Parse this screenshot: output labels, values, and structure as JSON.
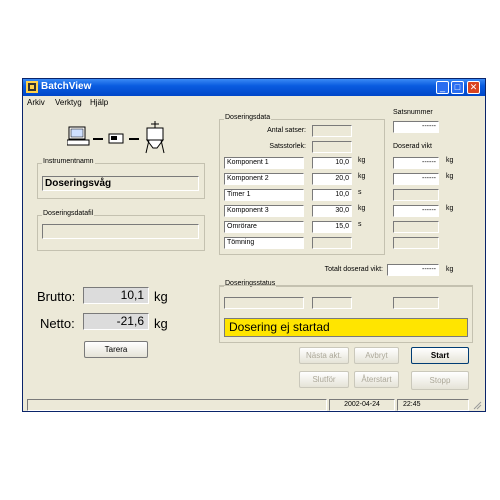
{
  "window": {
    "title": "BatchView"
  },
  "menu": {
    "items": [
      "Arkiv",
      "Verktyg",
      "Hjälp"
    ]
  },
  "instrument": {
    "group_label": "Instrumentnamn",
    "value": "Doseringsvåg"
  },
  "dosing_file": {
    "group_label": "Doseringsdatafil",
    "value": ""
  },
  "weights": {
    "brutto_label": "Brutto:",
    "brutto_value": "10,1",
    "netto_label": "Netto:",
    "netto_value": "-21,6",
    "unit": "kg"
  },
  "tare_button": "Tarera",
  "doseringsdata": {
    "group_label": "Doseringsdata",
    "antal_satser_label": "Antal satser:",
    "satsstorlek_label": "Satsstorlek:",
    "rows": [
      {
        "name": "Komponent 1",
        "value": "10,0",
        "unit": "kg",
        "dosed": "------",
        "dosed_unit": "kg"
      },
      {
        "name": "Komponent 2",
        "value": "20,0",
        "unit": "kg",
        "dosed": "------",
        "dosed_unit": "kg"
      },
      {
        "name": "Timer 1",
        "value": "10,0",
        "unit": "s",
        "dosed": "",
        "dosed_unit": ""
      },
      {
        "name": "Komponent 3",
        "value": "30,0",
        "unit": "kg",
        "dosed": "------",
        "dosed_unit": "kg"
      },
      {
        "name": "Omrörare",
        "value": "15,0",
        "unit": "s",
        "dosed": "",
        "dosed_unit": ""
      },
      {
        "name": "Tömning",
        "value": "",
        "unit": "",
        "dosed": "",
        "dosed_unit": ""
      }
    ]
  },
  "satsnummer": {
    "label": "Satsnummer",
    "value": "------"
  },
  "doserad_vikt_label": "Doserad vikt",
  "total": {
    "label": "Totalt doserad vikt:",
    "value": "------",
    "unit": "kg"
  },
  "doseringsstatus": {
    "group_label": "Doseringsstatus",
    "message": "Dosering ej startad"
  },
  "buttons": {
    "nasta_akt": "Nästa akt.",
    "avbryt": "Avbryt",
    "start": "Start",
    "slutfor": "Slutför",
    "aterstart": "Återstart",
    "stopp": "Stopp"
  },
  "statusbar": {
    "date": "2002-04-24",
    "time": "22:45"
  },
  "colors": {
    "status_yellow": "#ffe500",
    "titlebar": "#0a5ce0"
  }
}
